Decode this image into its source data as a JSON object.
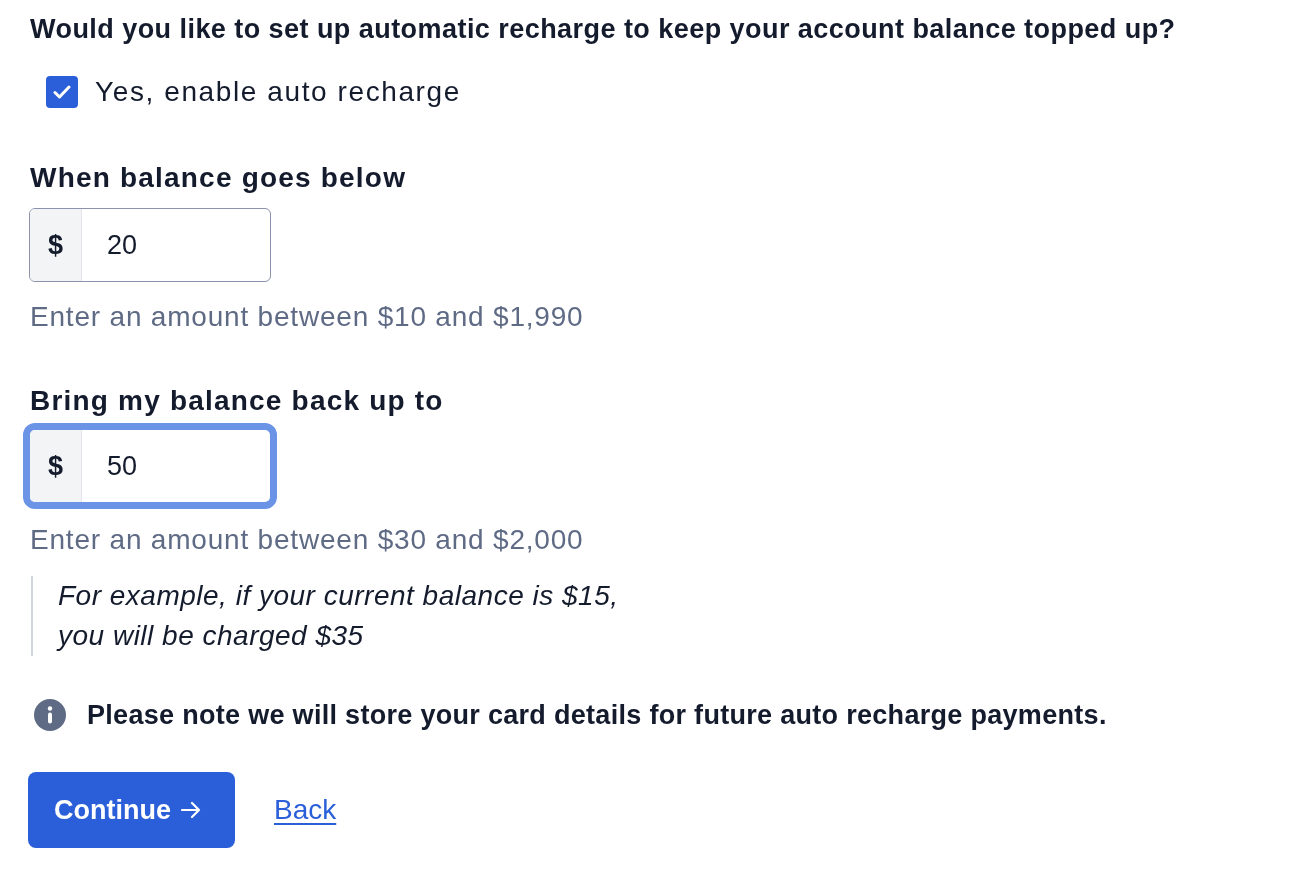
{
  "question": "Would you like to set up automatic recharge to keep your account balance topped up?",
  "auto_recharge": {
    "label": "Yes, enable auto recharge",
    "checked": true
  },
  "fields": [
    {
      "label": "When balance goes below",
      "prefix": "$",
      "value": "20",
      "focused": false,
      "hint": "Enter an amount between $10 and $1,990"
    },
    {
      "label": "Bring my balance back up to",
      "prefix": "$",
      "value": "50",
      "focused": true,
      "hint": "Enter an amount between $30 and $2,000"
    }
  ],
  "example": [
    "For example, if your current balance is $15,",
    "you will be charged $35"
  ],
  "note": "Please note we will store your card details for future auto recharge payments.",
  "actions": {
    "primary": "Continue",
    "secondary": "Back"
  }
}
